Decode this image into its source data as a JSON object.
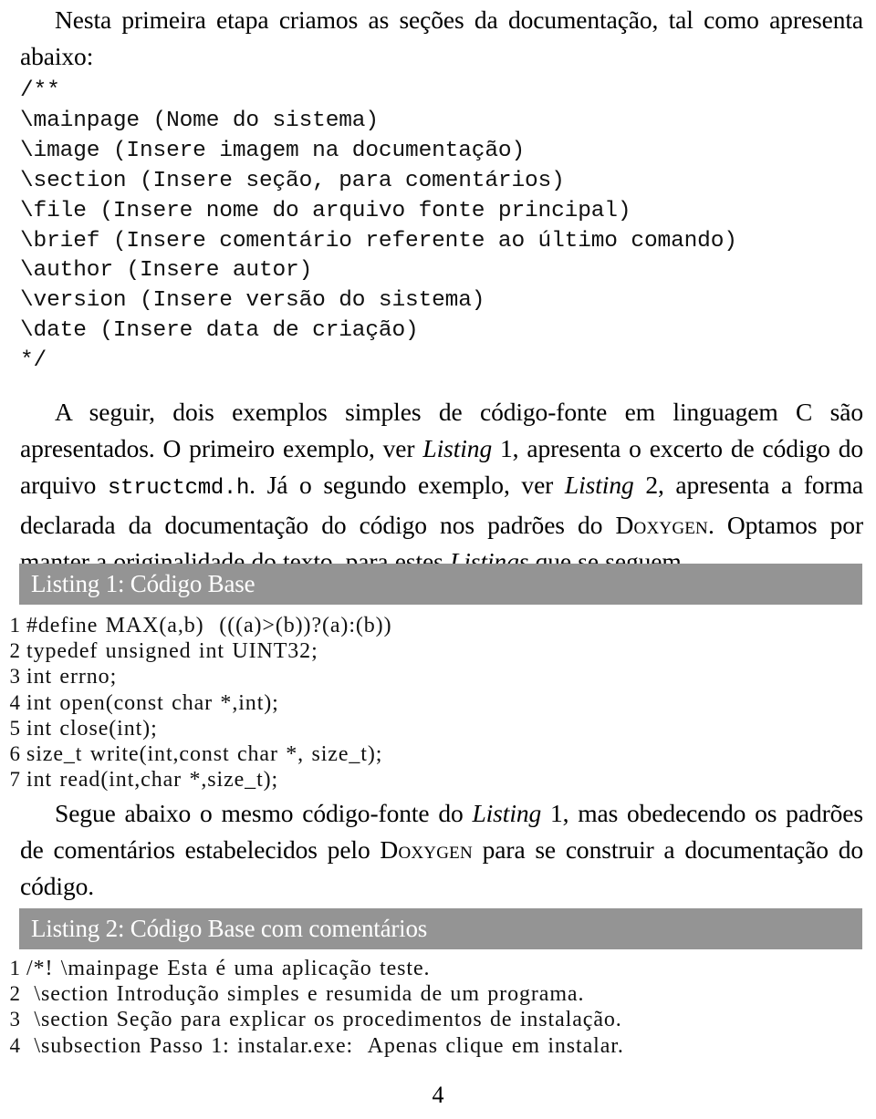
{
  "document": {
    "language": "pt-BR",
    "page_number": "4"
  },
  "paragraphs": {
    "intro": {
      "full_text": "Nesta primeira etapa criamos as seções da documentação, tal como apresenta abaixo:",
      "line_1": "Nesta primeira etapa criamos as seções da documentação, tal como apresenta",
      "line_2": "abaixo:"
    },
    "after_verbatim": {
      "segment_1": "A seguir, dois exemplos simples de código-fonte em linguagem C são apresentados. O primeiro exemplo, ver ",
      "italic_1": "Listing",
      "segment_2": " 1, apresenta o excerto de código do arquivo ",
      "mono_1": "structcmd.h",
      "segment_3": ". Já o segundo exemplo, ver ",
      "italic_2": "Listing",
      "segment_4": " 2, apresenta a forma declarada da documentação do código nos padrões do ",
      "smallcaps_1": "Doxygen",
      "segment_5": ". Optamos por manter a originalidade do texto, para estes ",
      "italic_3": "Listings",
      "segment_6": " que se seguem."
    },
    "between_listings": {
      "segment_1": "Segue abaixo o mesmo código-fonte do ",
      "italic_1": "Listing",
      "segment_2": " 1, mas obedecendo os padrões de comentários estabelecidos pelo ",
      "smallcaps_1": "Doxygen",
      "segment_3": " para se construir a documentação do código."
    }
  },
  "verbatim_block": {
    "lines": [
      "/**",
      "\\mainpage (Nome do sistema)",
      "\\image (Insere imagem na documentação)",
      "\\section (Insere seção, para comentários)",
      "\\file (Insere nome do arquivo fonte principal)",
      "\\brief (Insere comentário referente ao último comando)",
      "\\author (Insere autor)",
      "\\version (Insere versão do sistema)",
      "\\date (Insere data de criação)",
      "*/"
    ]
  },
  "listings": [
    {
      "caption": "Listing 1: Código Base",
      "bar_color": "#949494",
      "caption_color": "#ffffff",
      "lines": [
        {
          "number": "1",
          "code": "#define MAX(a,b)  (((a)>(b))?(a):(b))"
        },
        {
          "number": "2",
          "code": "typedef unsigned int UINT32;"
        },
        {
          "number": "3",
          "code": "int errno;"
        },
        {
          "number": "4",
          "code": "int open(const char *,int);"
        },
        {
          "number": "5",
          "code": "int close(int);"
        },
        {
          "number": "6",
          "code": "size_t write(int,const char *, size_t);"
        },
        {
          "number": "7",
          "code": "int read(int,char *,size_t);"
        }
      ]
    },
    {
      "caption": "Listing 2: Código Base com comentários",
      "bar_color": "#949494",
      "caption_color": "#ffffff",
      "lines": [
        {
          "number": "1",
          "code": "/*! \\mainpage Esta é uma aplicação teste."
        },
        {
          "number": "2",
          "code": " \\section Introdução simples e resumida de um programa."
        },
        {
          "number": "3",
          "code": " \\section Seção para explicar os procedimentos de instalação."
        },
        {
          "number": "4",
          "code": " \\subsection Passo 1: instalar.exe:  Apenas clique em instalar."
        }
      ]
    }
  ]
}
